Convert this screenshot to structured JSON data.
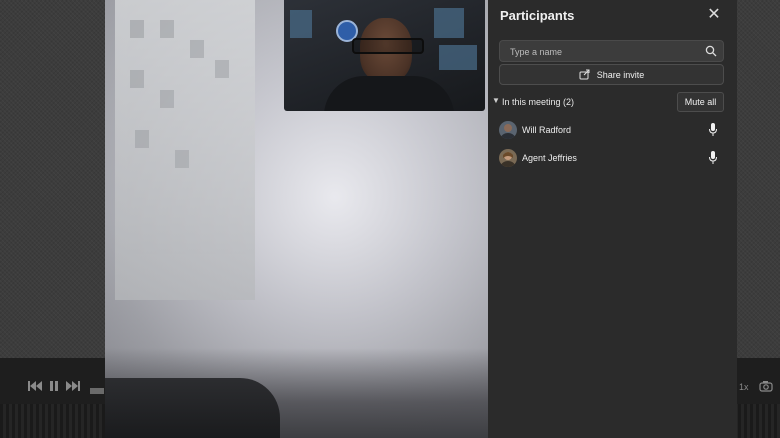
{
  "panel": {
    "title": "Participants",
    "close_icon": "close-icon",
    "search": {
      "placeholder": "Type a name",
      "value": ""
    },
    "share_label": "Share invite",
    "section_label": "In this meeting (2)",
    "mute_all_label": "Mute all",
    "participants": [
      {
        "name": "Will Radford",
        "mic": "microphone-icon"
      },
      {
        "name": "Agent Jeffries",
        "mic": "microphone-icon"
      }
    ]
  },
  "player": {
    "speed_label": "1x"
  },
  "colors": {
    "panel_bg": "#2b2b2b",
    "button_bg": "#333333",
    "text": "#f0f0f0"
  }
}
